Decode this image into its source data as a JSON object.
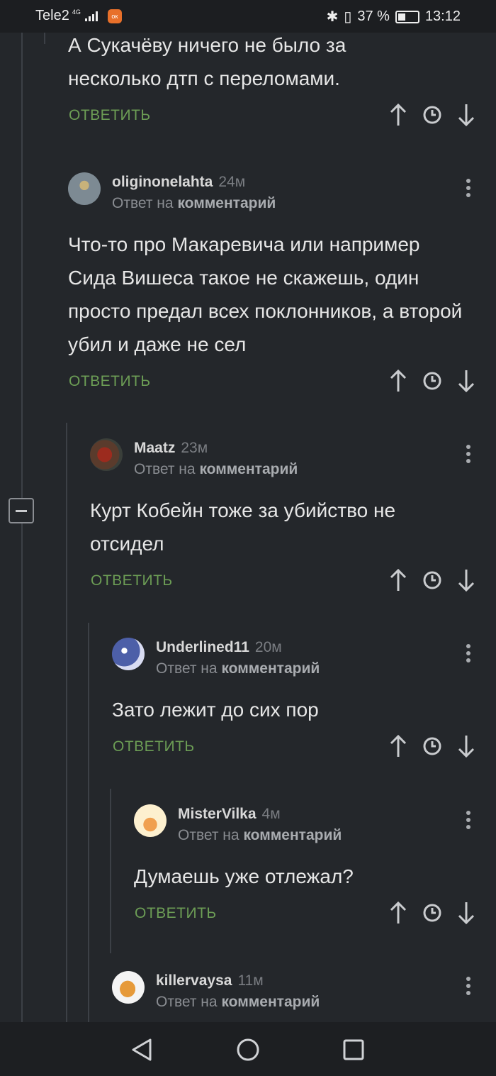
{
  "status_bar": {
    "carrier": "Tele2",
    "network": "4G",
    "battery": "37 %",
    "time": "13:12"
  },
  "reply_label": "ОТВЕТИТЬ",
  "reply_to_prefix": "Ответ на",
  "reply_to_link": "комментарий",
  "top_comment_tail": {
    "text": "А Сукачёву ничего не было за несколько дтп с переломами."
  },
  "comments": [
    {
      "username": "oliginonelahta",
      "time": "24м",
      "text": "Что-то про Макаревича или например Сида Вишеса такое не скажешь, один просто предал всех поклонников, а второй убил и даже не сел"
    },
    {
      "username": "Maatz",
      "time": "23м",
      "text": "Курт Кобейн тоже за убийство не отсидел"
    },
    {
      "username": "Underlined11",
      "time": "20м",
      "text": "Зато лежит до сих пор"
    },
    {
      "username": "MisterVilka",
      "time": "4м",
      "text": "Думаешь уже отлежал?"
    },
    {
      "username": "killervaysa",
      "time": "11м",
      "text": ""
    }
  ],
  "colors": {
    "background": "#24272b",
    "reply": "#6c9d55",
    "thread_line": "#3c4046"
  }
}
